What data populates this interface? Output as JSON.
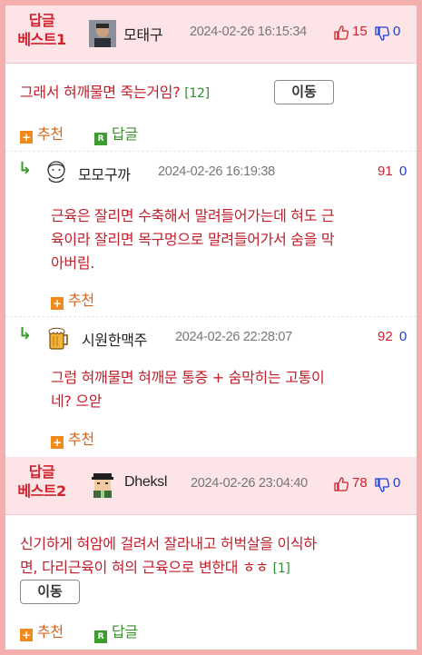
{
  "comments": [
    {
      "badge": "답글\n베스트1",
      "nick": "모태구",
      "date": "2024-02-26 16:15:34",
      "up": "15",
      "down": "0",
      "content": "그래서 혀깨물면 죽는거임?",
      "comment_count": "[12]",
      "move_label": "이동",
      "recommend_label": "추천",
      "reply_label": "답글"
    },
    {
      "nick": "모모구까",
      "date": "2024-02-26 16:19:38",
      "up": "91",
      "down": "0",
      "content_lines": [
        "근육은 잘리면 수축해서 말려들어가는데 혀도 근",
        "육이라 잘리면 목구멍으로 말려들어가서 숨을 막",
        "아버림."
      ],
      "recommend_label": "추천"
    },
    {
      "nick": "시원한맥주",
      "date": "2024-02-26 22:28:07",
      "up": "92",
      "down": "0",
      "content_lines": [
        "그럼 혀깨물면 혀깨문 통증 + 숨막히는 고통이",
        "네? 으앋"
      ],
      "recommend_label": "추천"
    },
    {
      "badge": "답글\n베스트2",
      "nick": "Dheksl",
      "date": "2024-02-26 23:04:40",
      "up": "78",
      "down": "0",
      "content_lines": [
        "신기하게 혀암에 걸려서 잘라내고 허벅살을 이식하",
        "면, 다리근육이 혀의 근육으로 변한대 ㅎㅎ"
      ],
      "comment_count": "[1]",
      "move_label": "이동",
      "recommend_label": "추천",
      "reply_label": "답글"
    }
  ],
  "colors": {
    "accent": "#d2202c",
    "down": "#1a3fd6",
    "border": "#f5aeae",
    "header_bg": "#fde4e6"
  },
  "icons": [
    "thumbs-up-icon",
    "thumbs-down-icon",
    "reply-arrow-icon",
    "plus-icon",
    "reply-icon"
  ]
}
